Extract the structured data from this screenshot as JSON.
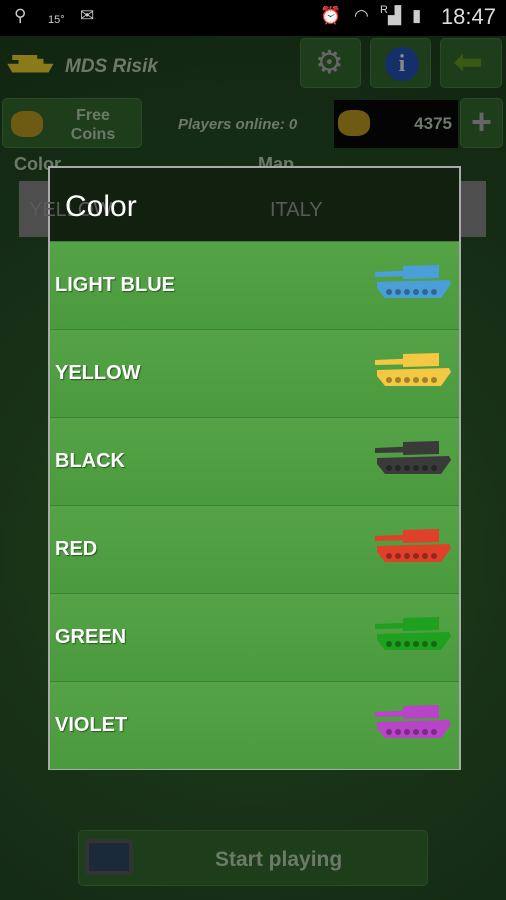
{
  "status": {
    "temperature": "15°",
    "time": "18:47",
    "network": "R"
  },
  "appbar": {
    "title": "MDS Risik",
    "icons": [
      "tank-icon",
      "gear-icon",
      "info-icon",
      "back-arrow-icon"
    ]
  },
  "toolbar": {
    "free_coins": "Free Coins",
    "players_online": "Players online: 0",
    "coins": "4375",
    "add": "+"
  },
  "form": {
    "color_label": "Color",
    "color_value": "YELLOW",
    "map_label": "Map",
    "map_value": "ITALY"
  },
  "dialog": {
    "title": "Color",
    "items": [
      {
        "label": "LIGHT BLUE",
        "color": "#4a9fd8"
      },
      {
        "label": "YELLOW",
        "color": "#f4c842"
      },
      {
        "label": "BLACK",
        "color": "#3a3a3a"
      },
      {
        "label": "RED",
        "color": "#e0402a"
      },
      {
        "label": "GREEN",
        "color": "#1fa01f"
      },
      {
        "label": "VIOLET",
        "color": "#b844c8"
      }
    ]
  },
  "start": {
    "label": "Start playing"
  }
}
